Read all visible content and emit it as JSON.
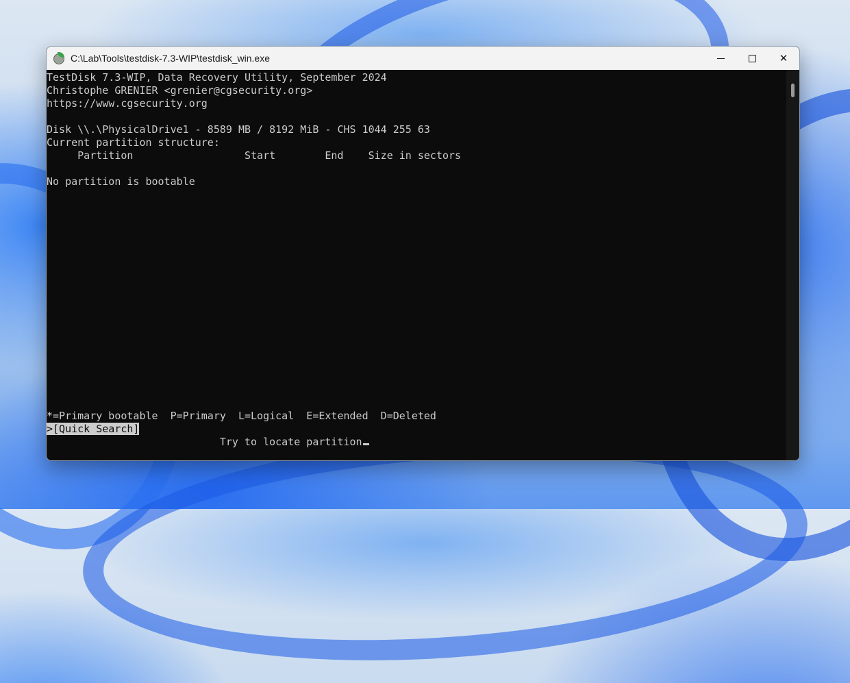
{
  "window": {
    "title": "C:\\Lab\\Tools\\testdisk-7.3-WIP\\testdisk_win.exe",
    "controls": {
      "minimize": "minimize",
      "maximize": "maximize",
      "close": "✕"
    }
  },
  "console": {
    "header_line1": "TestDisk 7.3-WIP, Data Recovery Utility, September 2024",
    "header_line2": "Christophe GRENIER <grenier@cgsecurity.org>",
    "header_line3": "https://www.cgsecurity.org",
    "disk_info": "Disk \\\\.\\PhysicalDrive1 - 8589 MB / 8192 MiB - CHS 1044 255 63",
    "structure_label": "Current partition structure:",
    "columns_header": "     Partition                  Start        End    Size in sectors",
    "bootable_message": "No partition is bootable",
    "legend": "*=Primary bootable  P=Primary  L=Logical  E=Extended  D=Deleted",
    "menu_prefix": ">",
    "menu_selected": "[Quick Search]",
    "hint": "                            Try to locate partition"
  },
  "colors": {
    "console_bg": "#0c0c0c",
    "console_fg": "#cccccc",
    "titlebar_bg": "#f3f3f3"
  }
}
